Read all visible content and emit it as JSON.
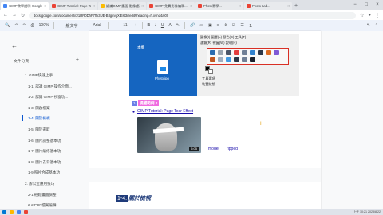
{
  "browser": {
    "tabs": [
      {
        "label": "GIMP教學說明-Google文件",
        "active": true,
        "color": "#4285f4"
      },
      {
        "label": "GIMP Tutorial: Page Tear",
        "active": false,
        "color": "#ea4335"
      },
      {
        "label": "認識GIMP畫面-影像處理...",
        "active": false,
        "color": "#fbbc04"
      },
      {
        "label": "GIMP-免費影像編輯...",
        "active": false,
        "color": "#ea4335"
      },
      {
        "label": "Photo教學...",
        "active": false,
        "color": "#ea4335"
      },
      {
        "label": "Photo Lab...",
        "active": false,
        "color": "#ea4335"
      }
    ],
    "url": "docs.google.com/document/d/1RR0DhF7f5i3UE-B3gm4jXiEst3ii/edit#heading=h.xvnd4ai00",
    "window_controls": [
      "−",
      "□",
      "×"
    ]
  },
  "toolbar": {
    "zoom": "100%",
    "style": "一般文字",
    "font": "Arial",
    "font_size": "11",
    "bold": "B",
    "italic": "I",
    "underline": "U",
    "text_color": "A"
  },
  "sidebar": {
    "title": "文件分頁",
    "add_icon": "+",
    "items": [
      {
        "label": "1. GIMP快速上手",
        "level": 1,
        "selected": false
      },
      {
        "label": "1-1. 認識 GIMP 操作介面...",
        "level": 2,
        "selected": false
      },
      {
        "label": "1-2. 認識 GIMP 視窗功...",
        "level": 2,
        "selected": false
      },
      {
        "label": "1-3. 開啟檔案",
        "level": 2,
        "selected": false
      },
      {
        "label": "1-4. 關於檢視",
        "level": 2,
        "selected": true
      },
      {
        "label": "1-5. 關於選取",
        "level": 2,
        "selected": false
      },
      {
        "label": "1-6. 圖片調整基本功",
        "level": 2,
        "selected": false
      },
      {
        "label": "1-7. 圖片編修基本功",
        "level": 2,
        "selected": false
      },
      {
        "label": "1-8. 圖片去背基本功",
        "level": 2,
        "selected": false
      },
      {
        "label": "1-9.照片合成基本功",
        "level": 2,
        "selected": false
      },
      {
        "label": "2. 辦公室應用技巧",
        "level": 1,
        "selected": false
      },
      {
        "label": "2-1.輕鬆畫圖調整",
        "level": 2,
        "selected": false
      },
      {
        "label": "2-2.PDF檔案編輯",
        "level": 2,
        "selected": false
      }
    ]
  },
  "document": {
    "screenshot": {
      "desktop_label": "本機",
      "file_name": "Photo.jpg",
      "menu_line1": "圖像(I)  圖層(L)  顏色(C)  工具(T)",
      "menu_line2": "濾鏡(R)  視窗(W)  說明(H)",
      "panel_label1": "工具選項",
      "panel_label2": "裝置狀態"
    },
    "h3_number": "1-",
    "h3_title": "提醒範例 2",
    "bullet_link": "GIMP Tutorial: Page Tear Effect",
    "video_duration": "5:05",
    "inline_links": [
      "model",
      "ripped"
    ],
    "h2_number": "1-4.",
    "h2_title": "關於檢視"
  },
  "taskbar": {
    "clock": "上午 10:21 2023/8/22"
  },
  "colors": {
    "accent": "#0b57d0",
    "highlight_red": "#d93025",
    "heading_pink": "#f06ce0",
    "heading_navy": "#1f3b7a"
  }
}
